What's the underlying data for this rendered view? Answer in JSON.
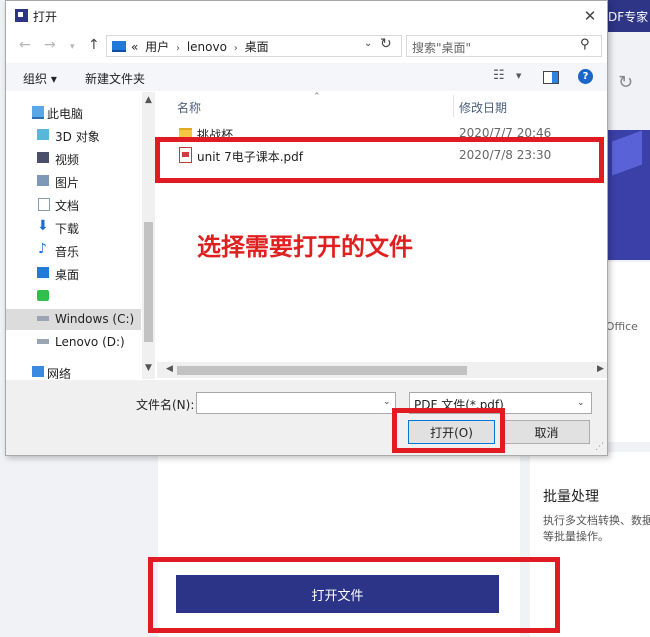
{
  "background_app": {
    "brand_text": "DF专家",
    "card_text": "t Office",
    "batch": {
      "title": "批量处理",
      "desc_line1": "执行多文档转换、数据",
      "desc_line2": "等批量操作。"
    },
    "open_file_button": "打开文件"
  },
  "dialog": {
    "title": "打开",
    "address": {
      "chevron": "«",
      "segments": [
        "用户",
        "lenovo",
        "桌面"
      ]
    },
    "search_placeholder": "搜索\"桌面\"",
    "toolbar": {
      "organize": "组织 ▾",
      "new_folder": "新建文件夹"
    },
    "nav_items": [
      {
        "label": "此电脑",
        "icon": "computer-icon"
      },
      {
        "label": "3D 对象",
        "icon": "3d-objects-icon"
      },
      {
        "label": "视频",
        "icon": "video-icon"
      },
      {
        "label": "图片",
        "icon": "pictures-icon"
      },
      {
        "label": "文档",
        "icon": "documents-icon"
      },
      {
        "label": "下载",
        "icon": "download-icon"
      },
      {
        "label": "音乐",
        "icon": "music-icon"
      },
      {
        "label": "桌面",
        "icon": "desktop-icon"
      },
      {
        "label": "",
        "icon": "app-green-icon"
      },
      {
        "label": "Windows (C:)",
        "icon": "drive-icon"
      },
      {
        "label": "Lenovo (D:)",
        "icon": "drive-icon"
      },
      {
        "label": "网络",
        "icon": "network-icon"
      }
    ],
    "columns": {
      "name": "名称",
      "date": "修改日期"
    },
    "files": [
      {
        "name": "挑战杯",
        "date": "2020/7/7 20:46",
        "icon": "folder-icon"
      },
      {
        "name": "unit 7电子课本.pdf",
        "date": "2020/7/8 23:30",
        "icon": "pdf-icon"
      }
    ],
    "annotation": "选择需要打开的文件",
    "filename_label": "文件名(N):",
    "filename_value": "",
    "filetype_value": "PDF 文件(*.pdf)",
    "open_button": "打开(O)",
    "cancel_button": "取消"
  },
  "colors": {
    "brand": "#2c3488",
    "highlight": "#e01b24"
  }
}
